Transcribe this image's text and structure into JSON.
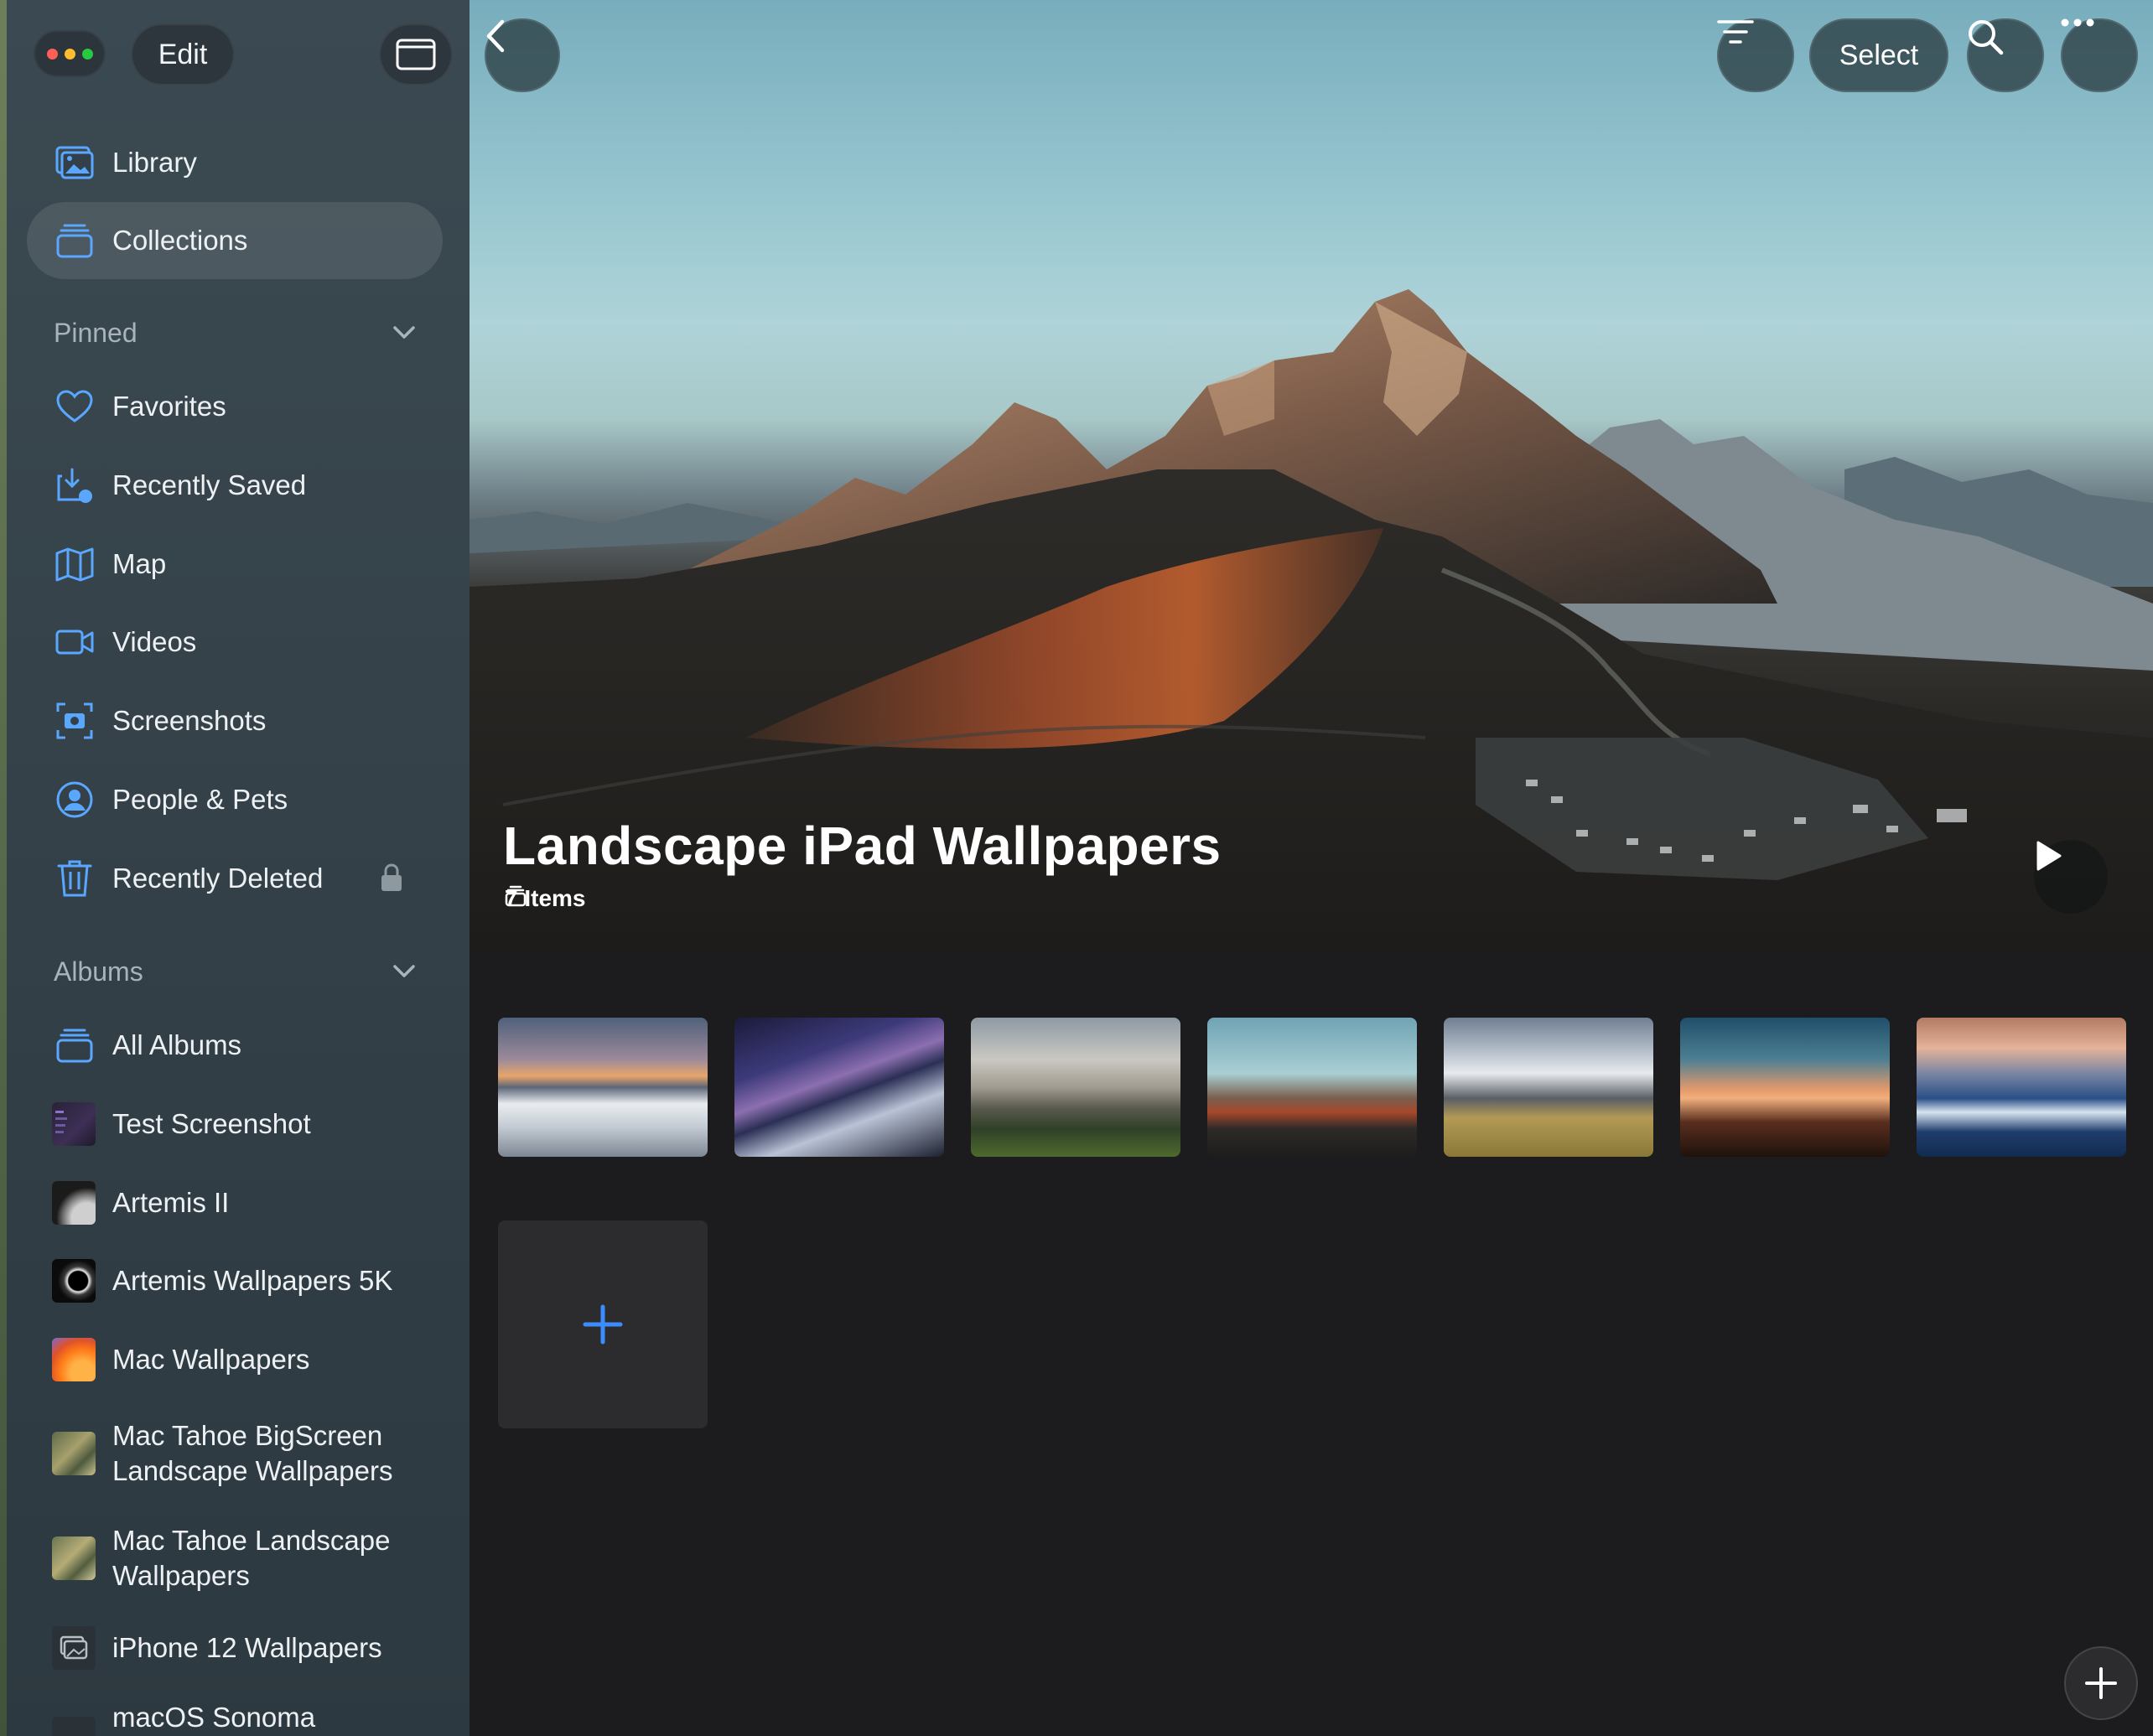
{
  "toolbar": {
    "edit_label": "Edit",
    "select_label": "Select"
  },
  "sidebar": {
    "top_items": [
      {
        "label": "Library",
        "icon": "photo-library-icon"
      },
      {
        "label": "Collections",
        "icon": "collections-icon",
        "selected": true
      }
    ],
    "pinned": {
      "title": "Pinned",
      "items": [
        {
          "label": "Favorites",
          "icon": "heart-icon"
        },
        {
          "label": "Recently Saved",
          "icon": "recently-saved-icon"
        },
        {
          "label": "Map",
          "icon": "map-icon"
        },
        {
          "label": "Videos",
          "icon": "video-icon"
        },
        {
          "label": "Screenshots",
          "icon": "screenshot-icon"
        },
        {
          "label": "People & Pets",
          "icon": "person-icon"
        },
        {
          "label": "Recently Deleted",
          "icon": "trash-icon",
          "locked": true
        }
      ]
    },
    "albums": {
      "title": "Albums",
      "items": [
        {
          "label": "All Albums",
          "icon": "albums-icon"
        },
        {
          "label": "Test Screenshot",
          "icon": "test-screenshot-thumb"
        },
        {
          "label": "Artemis II",
          "icon": "artemis-thumb"
        },
        {
          "label": "Artemis Wallpapers 5K",
          "icon": "eclipse-thumb"
        },
        {
          "label": "Mac Wallpapers",
          "icon": "mac-wallpaper-thumb"
        },
        {
          "label": "Mac Tahoe BigScreen Landscape Wallpapers",
          "icon": "tahoe-thumb"
        },
        {
          "label": "Mac Tahoe Landscape Wallpapers",
          "icon": "tahoe-thumb"
        },
        {
          "label": "iPhone 12 Wallpapers",
          "icon": "photo-stack-icon"
        },
        {
          "label": "macOS Sonoma",
          "icon": "photo-stack-icon"
        }
      ]
    }
  },
  "album": {
    "title": "Landscape iPad Wallpapers",
    "count": "7 Items"
  },
  "photos": [
    {
      "name": "alpine-sea-of-clouds"
    },
    {
      "name": "milky-way-mountains"
    },
    {
      "name": "rocky-peak-forest"
    },
    {
      "name": "dolomites-sunset"
    },
    {
      "name": "snowy-peak-meadow"
    },
    {
      "name": "sunset-grass"
    },
    {
      "name": "ocean-wave"
    }
  ],
  "colors": {
    "accent": "#3b8cff",
    "sidebar_bg": "#36434b",
    "main_bg": "#1c1c1e"
  }
}
